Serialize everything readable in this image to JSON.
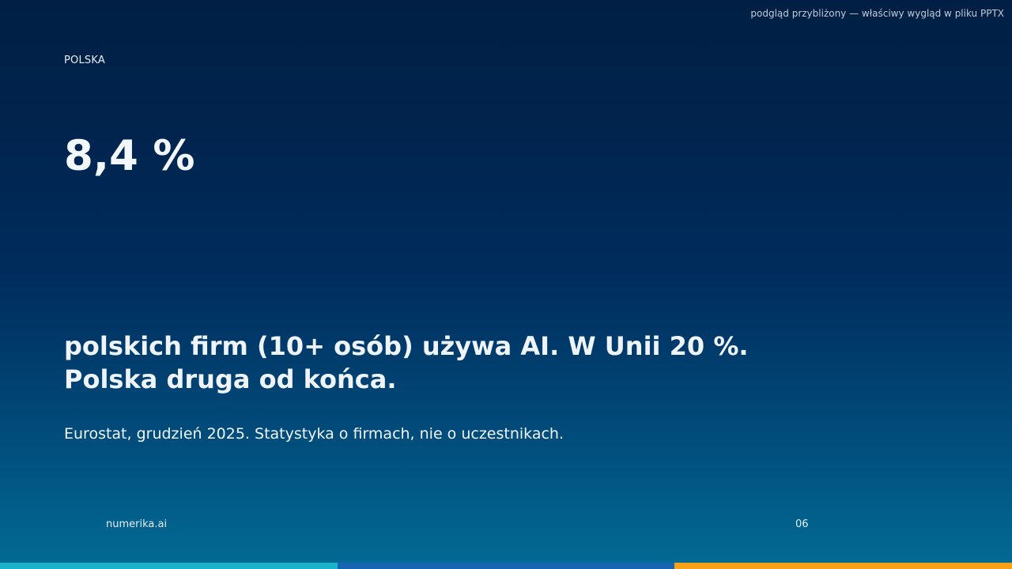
{
  "preview_note": "podgląd przybliżony — właściwy wygląd w pliku PPTX",
  "slide": {
    "kicker": "POLSKA",
    "big_number": "8,4 %",
    "headline": "polskich firm (10+ osób) używa AI. W Unii 20 %. Polska druga od końca.",
    "source": "Eurostat, grudzień 2025. Statystyka o firmach, nie o uczestnikach."
  },
  "footer": {
    "brand": "numerika.ai",
    "page_number": "06"
  },
  "colors": {
    "bar_teal": "#1ab3c7",
    "bar_blue": "#1765b0",
    "bar_orange": "#f8a219"
  }
}
